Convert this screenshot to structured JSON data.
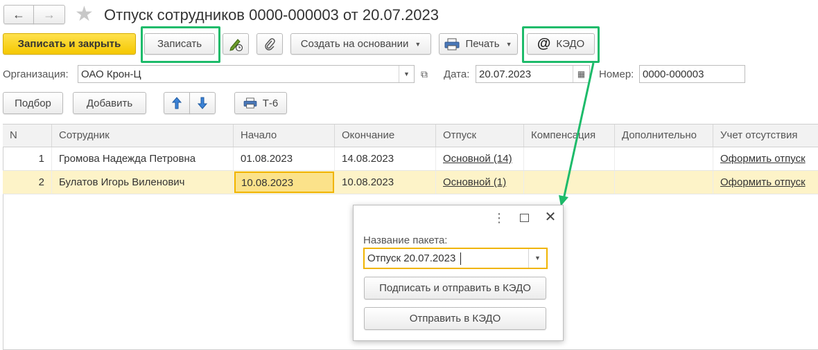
{
  "header": {
    "title": "Отпуск сотрудников 0000-000003 от 20.07.2023"
  },
  "toolbar": {
    "save_close": "Записать и закрыть",
    "save": "Записать",
    "create_based": "Создать на основании",
    "print": "Печать",
    "kedo": "КЭДО"
  },
  "form": {
    "org_label": "Организация:",
    "org_value": "ОАО Крон-Ц",
    "date_label": "Дата:",
    "date_value": "20.07.2023",
    "number_label": "Номер:",
    "number_value": "0000-000003"
  },
  "table_toolbar": {
    "pick": "Подбор",
    "add": "Добавить",
    "t6": "Т-6"
  },
  "table": {
    "columns": [
      "N",
      "Сотрудник",
      "Начало",
      "Окончание",
      "Отпуск",
      "Компенсация",
      "Дополнительно",
      "Учет отсутствия"
    ],
    "rows": [
      {
        "n": "1",
        "employee": "Громова Надежда Петровна",
        "start": "01.08.2023",
        "end": "14.08.2023",
        "vacation": "Основной (14)",
        "compensation": "",
        "additional": "",
        "absence": "Оформить отпуск"
      },
      {
        "n": "2",
        "employee": "Булатов Игорь Виленович",
        "start": "10.08.2023",
        "end": "10.08.2023",
        "vacation": "Основной (1)",
        "compensation": "",
        "additional": "",
        "absence": "Оформить отпуск"
      }
    ]
  },
  "popup": {
    "package_label": "Название пакета:",
    "package_value": "Отпуск 20.07.2023",
    "sign_send": "Подписать и отправить в КЭДО",
    "send": "Отправить в КЭДО"
  },
  "colors": {
    "highlight": "#1dbb6a",
    "accent_yellow": "#f5c800",
    "selected_row": "#fdf3c8"
  }
}
